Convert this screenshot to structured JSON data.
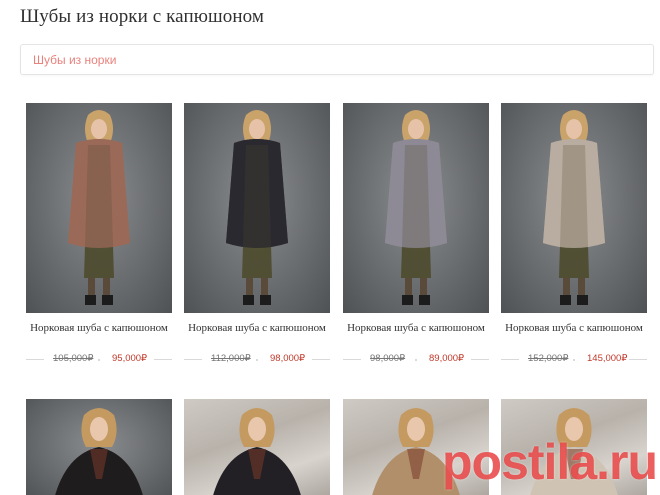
{
  "page": {
    "title": "Шубы из норки с капюшоном"
  },
  "breadcrumb": {
    "link": "Шубы из норки"
  },
  "products": [
    {
      "title": "Норковая шуба с капюшоном",
      "old_price": "105,000₽",
      "new_price": "95,000₽",
      "coat_color": "#9a6a58",
      "bg": "studio"
    },
    {
      "title": "Норковая шуба с капюшоном",
      "old_price": "112,000₽",
      "new_price": "98,000₽",
      "coat_color": "#2b2a30",
      "bg": "studio"
    },
    {
      "title": "Норковая шуба с капюшоном",
      "old_price": "98,000₽",
      "new_price": "89,000₽",
      "coat_color": "#8d8a96",
      "bg": "studio"
    },
    {
      "title": "Норковая шуба с капюшоном",
      "old_price": "152,000₽",
      "new_price": "145,000₽",
      "coat_color": "#b9aca0",
      "bg": "studio"
    }
  ],
  "products_row2": [
    {
      "coat_color": "#1f1c1d",
      "bg": "studio"
    },
    {
      "coat_color": "#222024",
      "bg": "wall"
    },
    {
      "coat_color": "#b08f6a",
      "bg": "wall"
    },
    {
      "coat_color": "#cfc3b3",
      "bg": "wall"
    }
  ],
  "watermark": "postila.ru"
}
